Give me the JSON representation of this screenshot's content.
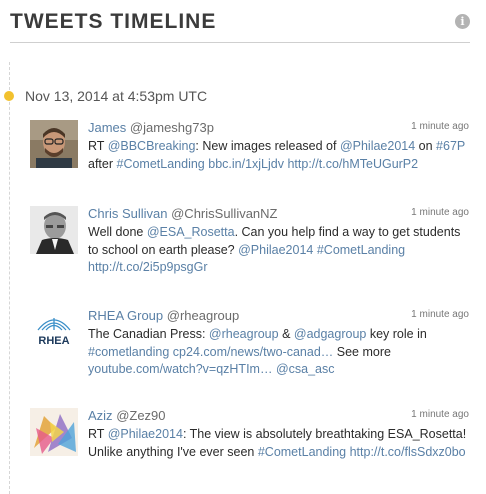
{
  "header": {
    "title": "TWEETS TIMELINE",
    "info_glyph": "i"
  },
  "date_label": "Nov 13, 2014 at 4:53pm UTC",
  "colors": {
    "accent_link": "#5a80a6",
    "timeline_dot": "#f2c12e"
  },
  "tweets": [
    {
      "name": "James",
      "handle": "@jameshg73p",
      "time": "1 minute ago",
      "avatar": "avatar-photo-man-glasses",
      "parts": [
        "RT ",
        "@BBCBreaking",
        ": New images released of ",
        "@Philae2014",
        " on ",
        "#67P",
        " after ",
        "#CometLanding",
        " ",
        "bbc.in/1xjLjdv",
        " ",
        "http://t.co/hMTeUGurP2"
      ]
    },
    {
      "name": "Chris Sullivan",
      "handle": "@ChrisSullivanNZ",
      "time": "1 minute ago",
      "avatar": "avatar-photo-man-suit",
      "parts": [
        "Well done ",
        "@ESA_Rosetta",
        ". Can you help find a way to get students to school on earth please? ",
        "@Philae2014",
        " ",
        "#CometLanding",
        " ",
        "http://t.co/2i5p9psgGr"
      ]
    },
    {
      "name": "RHEA Group",
      "handle": "@rheagroup",
      "time": "1 minute ago",
      "avatar": "rhea-logo",
      "avatar_text": "RHEA",
      "parts": [
        "The Canadian Press: ",
        "@rheagroup",
        " & ",
        "@adgagroup",
        " key role in ",
        "#cometlanding",
        " ",
        "cp24.com/news/two-canad…",
        " See more ",
        "youtube.com/watch?v=qzHTIm…",
        " ",
        "@csa_asc"
      ]
    },
    {
      "name": "Aziz",
      "handle": "@Zez90",
      "time": "1 minute ago",
      "avatar": "avatar-colorful-art",
      "parts": [
        "RT ",
        "@Philae2014",
        ": The view is absolutely breathtaking ESA_Rosetta! Unlike anything I've ever seen ",
        "#CometLanding",
        " ",
        "http://t.co/flsSdxz0bo"
      ]
    }
  ]
}
